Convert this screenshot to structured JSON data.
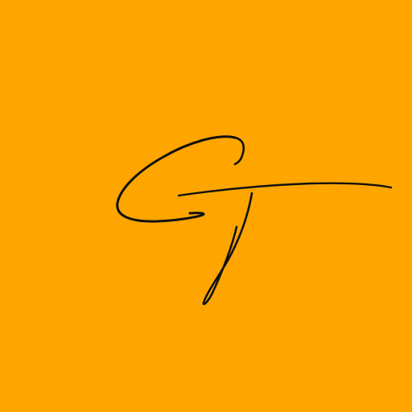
{
  "logo": {
    "monogram": "GT",
    "background_color": "#FFA500",
    "ink_color": "#111111"
  }
}
